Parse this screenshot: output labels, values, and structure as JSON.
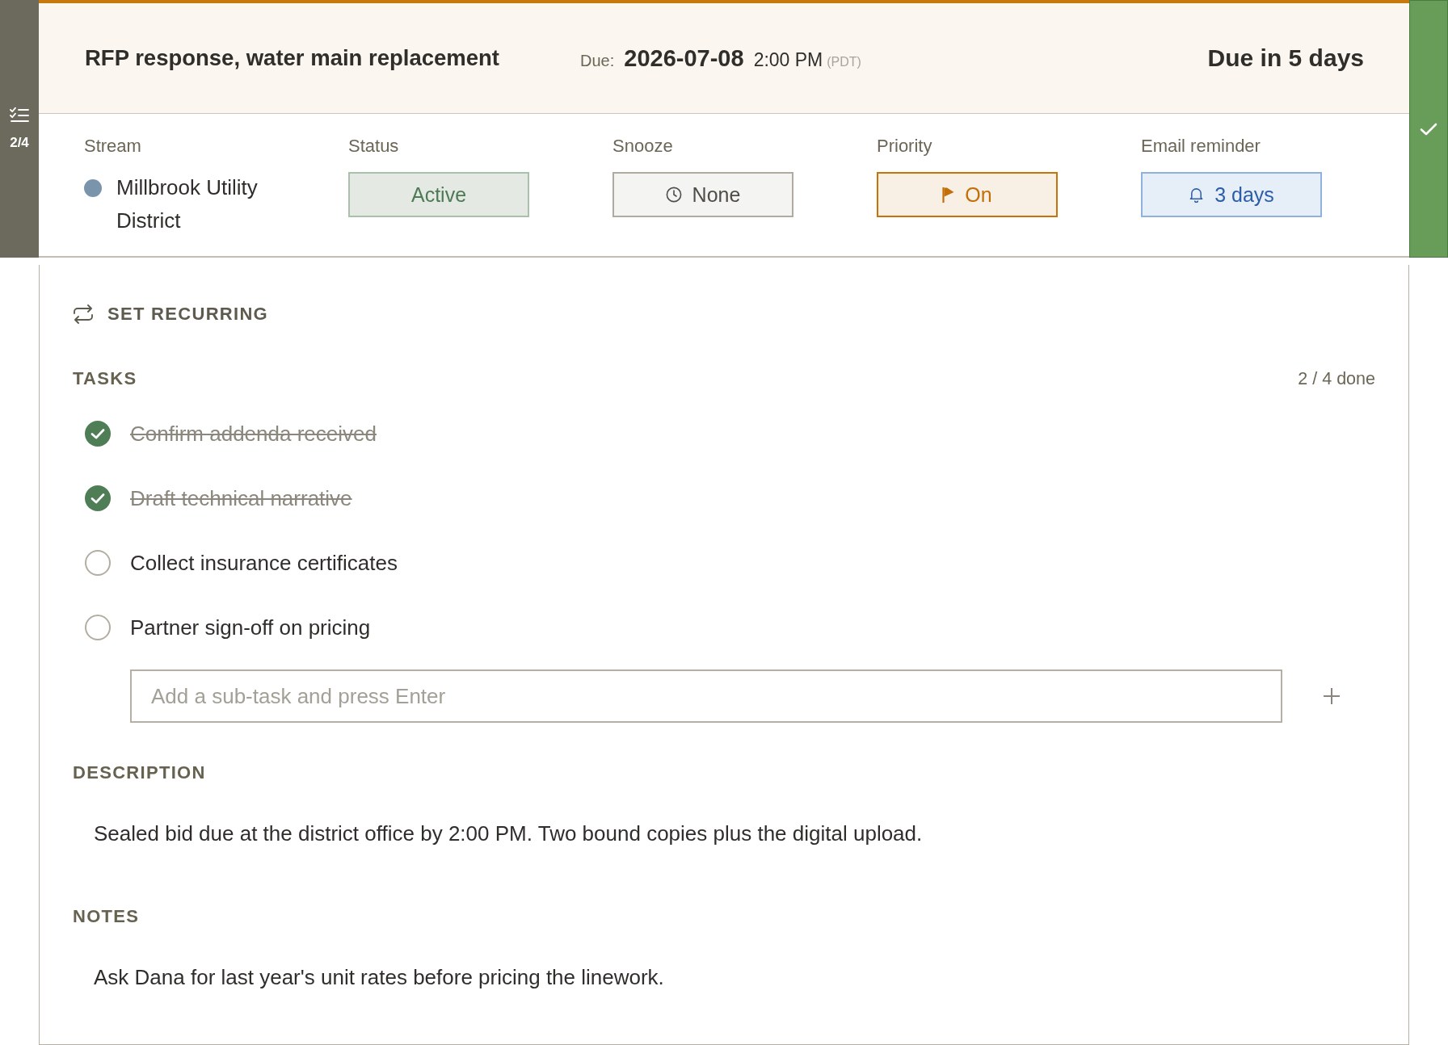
{
  "side_strip": {
    "count": "2/4"
  },
  "header": {
    "title": "RFP response, water main replacement",
    "due_label": "Due:",
    "due_date": "2026-07-08",
    "due_time": "2:00 PM",
    "timezone": "(PDT)",
    "countdown": "Due in 5 days"
  },
  "properties": [
    {
      "kind": "stream",
      "label": "Stream",
      "value": "Millbrook Utility District",
      "color": "#7a95ab"
    },
    {
      "kind": "status",
      "label": "Status",
      "value": "Active"
    },
    {
      "kind": "snooze",
      "label": "Snooze",
      "value": "None"
    },
    {
      "kind": "priority",
      "label": "Priority",
      "value": "On",
      "on": true
    },
    {
      "kind": "reminder",
      "label": "Email reminder",
      "value": "3 days"
    }
  ],
  "recurring": {
    "label": "SET RECURRING"
  },
  "tasks": {
    "heading": "TASKS",
    "done_count": "2 / 4 done",
    "items": [
      {
        "text": "Confirm addenda received",
        "checked": true
      },
      {
        "text": "Draft technical narrative",
        "checked": true
      },
      {
        "text": "Collect insurance certificates",
        "checked": false
      },
      {
        "text": "Partner sign-off on pricing",
        "checked": false
      }
    ],
    "new_task": {
      "placeholder": "Add a sub-task and press Enter"
    }
  },
  "description": {
    "heading": "DESCRIPTION",
    "text": "Sealed bid due at the district office by 2:00 PM. Two bound copies plus the digital upload."
  },
  "notes": {
    "heading": "NOTES",
    "text": "Ask Dana for last year's unit rates before pricing the linework."
  }
}
